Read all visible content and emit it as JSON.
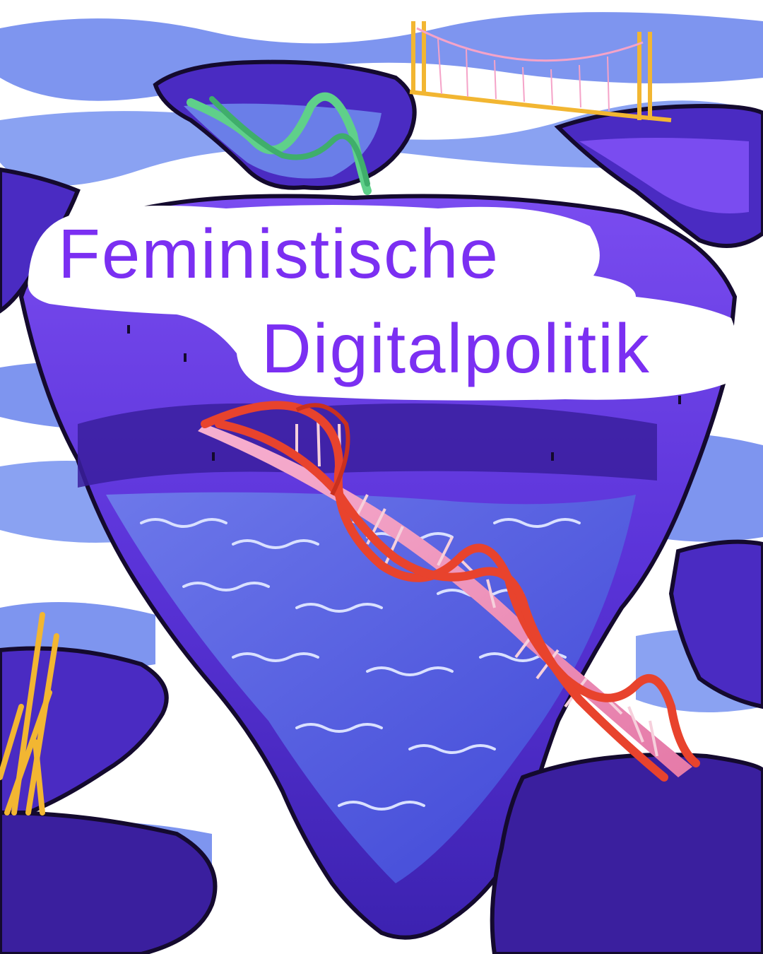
{
  "poster": {
    "title_line_1": "Feministische",
    "title_line_2": "Digitalpolitik"
  },
  "colors": {
    "title_text": "#7b2ff2",
    "title_cloud": "#ffffff",
    "sky_white": "#ffffff",
    "water_light": "#8aa2f2",
    "water_mid": "#5563e0",
    "rock_dark": "#3a1f9e",
    "rock_mid": "#6b3ee6",
    "rock_light": "#9a6cf0",
    "outline": "#140a2e",
    "dna_red": "#e8432d",
    "dna_pink": "#f3a0c8",
    "bridge_yellow": "#f2b632",
    "dna_green": "#5fd08a"
  },
  "illustration": {
    "elements": [
      "floating-rock-islands",
      "sea-waves",
      "dna-helix-bridge",
      "suspension-bridge",
      "green-helix",
      "yellow-grass"
    ]
  }
}
